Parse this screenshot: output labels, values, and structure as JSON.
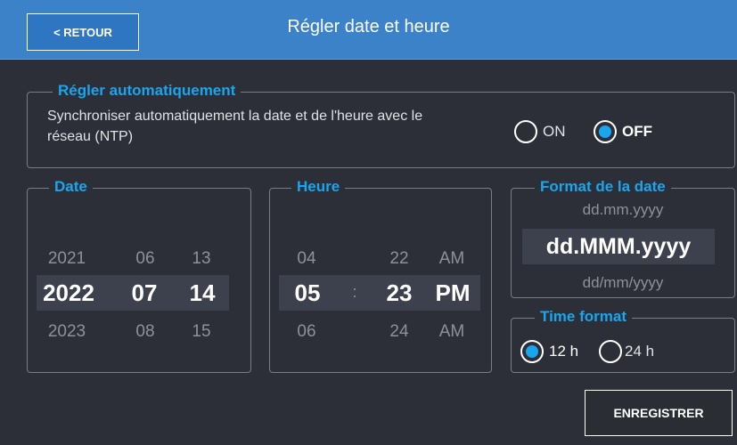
{
  "header": {
    "back_label": "< RETOUR",
    "title": "Régler date et heure"
  },
  "auto_set": {
    "legend": "Régler automatiquement",
    "description": "Synchroniser automatiquement la date et de l'heure avec le réseau (NTP)",
    "on_label": "ON",
    "off_label": "OFF",
    "selected": "OFF"
  },
  "date": {
    "legend": "Date",
    "rows": [
      {
        "year": "2021",
        "month": "06",
        "day": "13"
      },
      {
        "year": "2022",
        "month": "07",
        "day": "14"
      },
      {
        "year": "2023",
        "month": "08",
        "day": "15"
      }
    ]
  },
  "time": {
    "legend": "Heure",
    "separator": ":",
    "rows": [
      {
        "hour": "04",
        "minute": "22",
        "ampm": "AM"
      },
      {
        "hour": "05",
        "minute": "23",
        "ampm": "PM"
      },
      {
        "hour": "06",
        "minute": "24",
        "ampm": "AM"
      }
    ]
  },
  "date_format": {
    "legend": "Format de la date",
    "above": "dd.mm.yyyy",
    "selected": "dd.MMM.yyyy",
    "below": "dd/mm/yyyy"
  },
  "time_format": {
    "legend": "Time format",
    "option_12": "12 h",
    "option_24": "24 h",
    "selected": "12 h"
  },
  "save_label": "ENREGISTRER",
  "colors": {
    "accent": "#1aa6ee",
    "header": "#3b82c9",
    "background": "#2d2f38"
  }
}
